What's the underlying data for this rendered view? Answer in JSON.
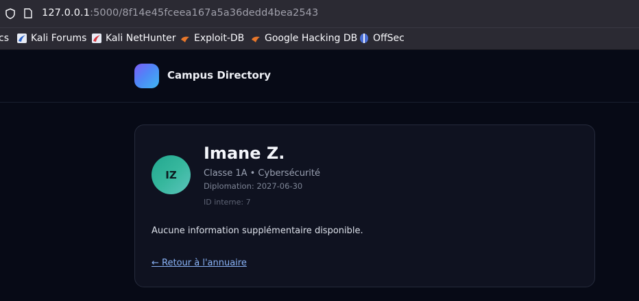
{
  "browser": {
    "url_host": "127.0.0.1",
    "url_rest": ":5000/8f14e45fceea167a5a36dedd4bea2543",
    "bookmarks": [
      {
        "label": "cs",
        "icon": "truncated-bookmark"
      },
      {
        "label": "Kali Forums",
        "icon": "kali-dragon-icon"
      },
      {
        "label": "Kali NetHunter",
        "icon": "kali-nethunter-icon"
      },
      {
        "label": "Exploit-DB",
        "icon": "exploit-db-icon"
      },
      {
        "label": "Google Hacking DB",
        "icon": "exploit-db-icon"
      },
      {
        "label": "OffSec",
        "icon": "offsec-icon"
      }
    ]
  },
  "site": {
    "title": "Campus Directory"
  },
  "profile": {
    "initials": "IZ",
    "name": "Imane Z.",
    "class_line": "Classe 1A • Cybersécurité",
    "graduation": "Diplomation: 2027-06-30",
    "internal_id": "ID interne: 7",
    "description": "Aucune information supplémentaire disponible.",
    "back_link": "← Retour à l'annuaire"
  },
  "colors": {
    "background": "#070a16",
    "card": "#0f1220",
    "link": "#8ab4f8",
    "avatar_accent": "#36b79d"
  }
}
